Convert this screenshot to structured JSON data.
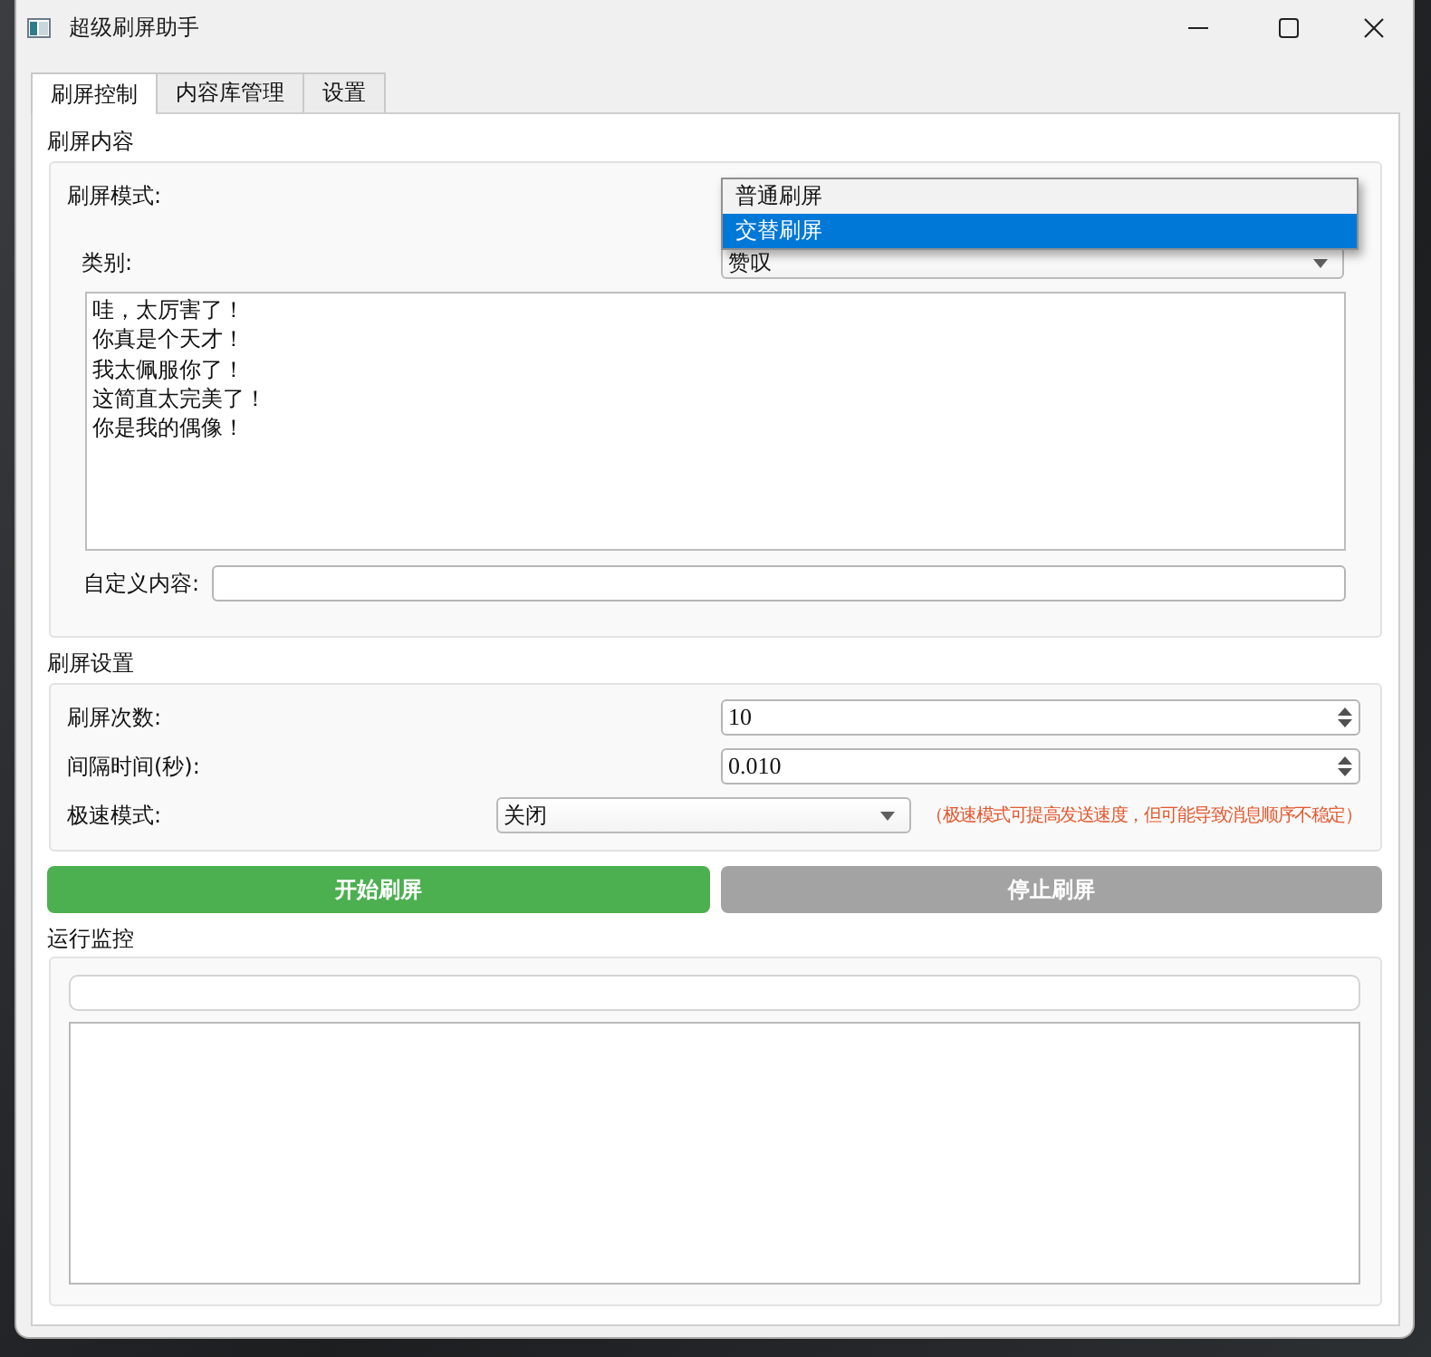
{
  "window": {
    "title": "超级刷屏助手"
  },
  "tabs": [
    {
      "label": "刷屏控制",
      "selected": true
    },
    {
      "label": "内容库管理",
      "selected": false
    },
    {
      "label": "设置",
      "selected": false
    }
  ],
  "content_section": {
    "title": "刷屏内容",
    "mode": {
      "label": "刷屏模式:",
      "dropdown_options": [
        {
          "label": "普通刷屏",
          "selected": false
        },
        {
          "label": "交替刷屏",
          "selected": true
        }
      ]
    },
    "category": {
      "label": "类别:",
      "value": "赞叹"
    },
    "messages": [
      "哇，太厉害了！",
      "你真是个天才！",
      "我太佩服你了！",
      "这简直太完美了！",
      "你是我的偶像！"
    ],
    "custom_content": {
      "label": "自定义内容:"
    }
  },
  "settings_section": {
    "title": "刷屏设置",
    "count": {
      "label": "刷屏次数:",
      "value": "10"
    },
    "interval": {
      "label": "间隔时间(秒):",
      "value": "0.010"
    },
    "turbo_mode": {
      "label": "极速模式:",
      "value": "关闭",
      "hint": "（极速模式可提高发送速度，但可能导致消息顺序不稳定）"
    }
  },
  "buttons": [
    {
      "label": "开始刷屏",
      "disabled": false
    },
    {
      "label": "停止刷屏",
      "disabled": true
    }
  ],
  "monitor_section": {
    "title": "运行监控",
    "progress": {
      "level": 0
    }
  }
}
